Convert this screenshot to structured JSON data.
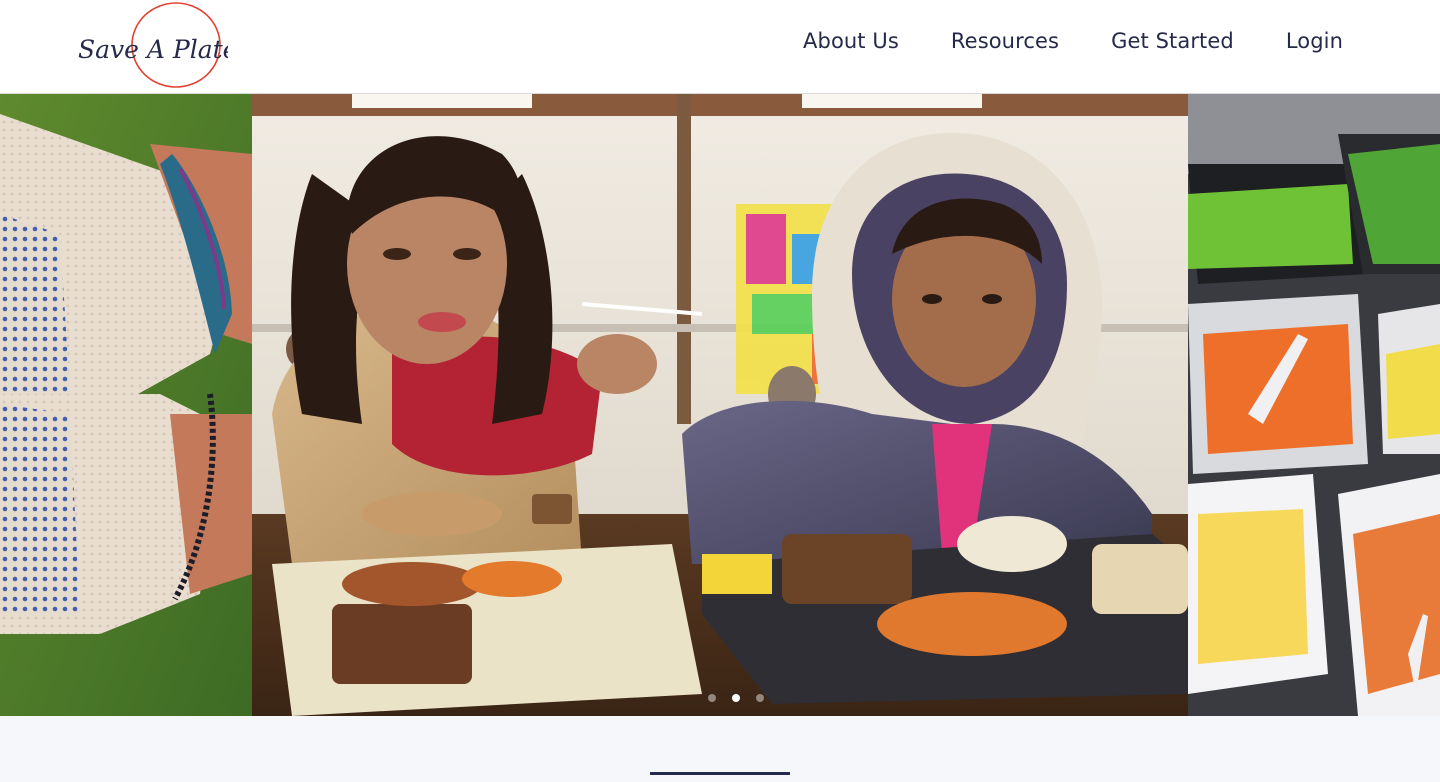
{
  "brand": {
    "name": "Save A Plate",
    "logo_text": "Save A Plate",
    "logo_ring_color": "#e3412f"
  },
  "nav": {
    "items": [
      {
        "label": "About Us"
      },
      {
        "label": "Resources"
      },
      {
        "label": "Get Started"
      },
      {
        "label": "Login"
      }
    ],
    "text_color": "#262a4a"
  },
  "carousel": {
    "slides": [
      {
        "subject": "hands wearing knit gloves and beaded bracelets"
      },
      {
        "subject": "woman and child in hooded coat eating a meal from cafeteria trays"
      },
      {
        "subject": "buffet trays of vegetables, carrots and sauces"
      }
    ],
    "active_slide": 2,
    "slide_count": 3
  },
  "section": {
    "divider_color": "#262a4a",
    "background": "#f6f7fb"
  }
}
